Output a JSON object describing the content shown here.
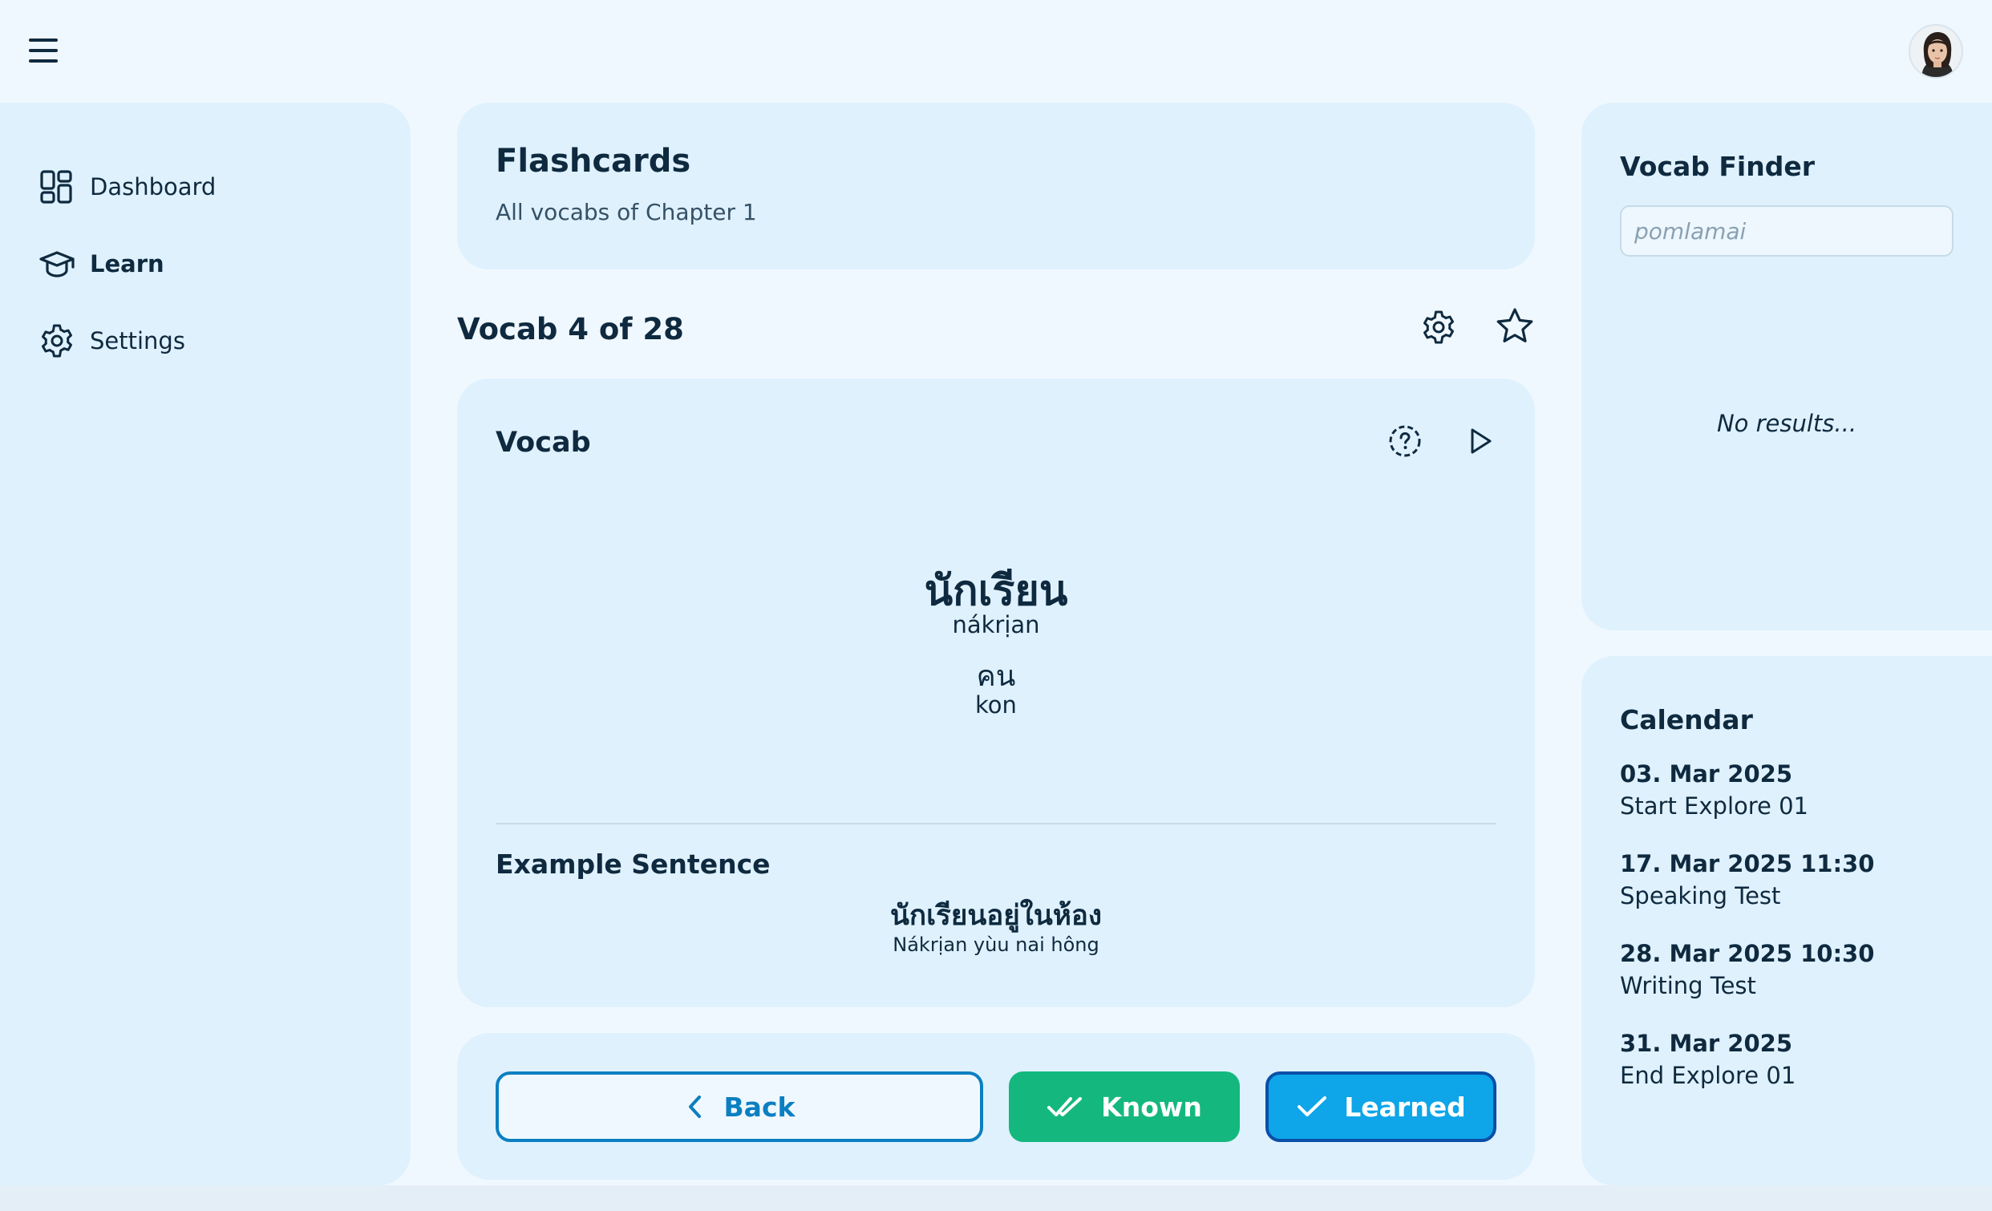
{
  "topbar": {
    "menu_icon": "hamburger-icon",
    "avatar": "user-avatar"
  },
  "sidebar": {
    "items": [
      {
        "label": "Dashboard",
        "icon": "dashboard-icon",
        "active": false
      },
      {
        "label": "Learn",
        "icon": "graduation-cap-icon",
        "active": true
      },
      {
        "label": "Settings",
        "icon": "gear-icon",
        "active": false
      }
    ]
  },
  "header": {
    "title": "Flashcards",
    "subtitle": "All vocabs of Chapter 1"
  },
  "progress": {
    "label": "Vocab 4 of 28",
    "current": 4,
    "total": 28
  },
  "vocab_card": {
    "title": "Vocab",
    "word_thai": "นักเรียน",
    "word_roman": "nákrịan",
    "classifier_thai": "คน",
    "classifier_roman": "kon",
    "example_title": "Example Sentence",
    "example_thai": "นักเรียนอยู่ในห้อง",
    "example_roman": "Nákrịan yùu nai hông"
  },
  "actions": {
    "back": "Back",
    "known": "Known",
    "learned": "Learned"
  },
  "finder": {
    "title": "Vocab Finder",
    "placeholder": "pomlamai",
    "empty_text": "No results..."
  },
  "calendar": {
    "title": "Calendar",
    "events": [
      {
        "date": "03. Mar 2025",
        "name": "Start Explore 01"
      },
      {
        "date": "17. Mar 2025 11:30",
        "name": "Speaking Test"
      },
      {
        "date": "28. Mar 2025 10:30",
        "name": "Writing Test"
      },
      {
        "date": "31. Mar 2025",
        "name": "End Explore 01"
      }
    ]
  },
  "colors": {
    "panel": "#dff1fd",
    "background": "#f0f8ff",
    "known": "#14b87e",
    "learned": "#0ea5e9",
    "primary_text": "#0f2a3f",
    "back_border": "#0b7fc1"
  }
}
